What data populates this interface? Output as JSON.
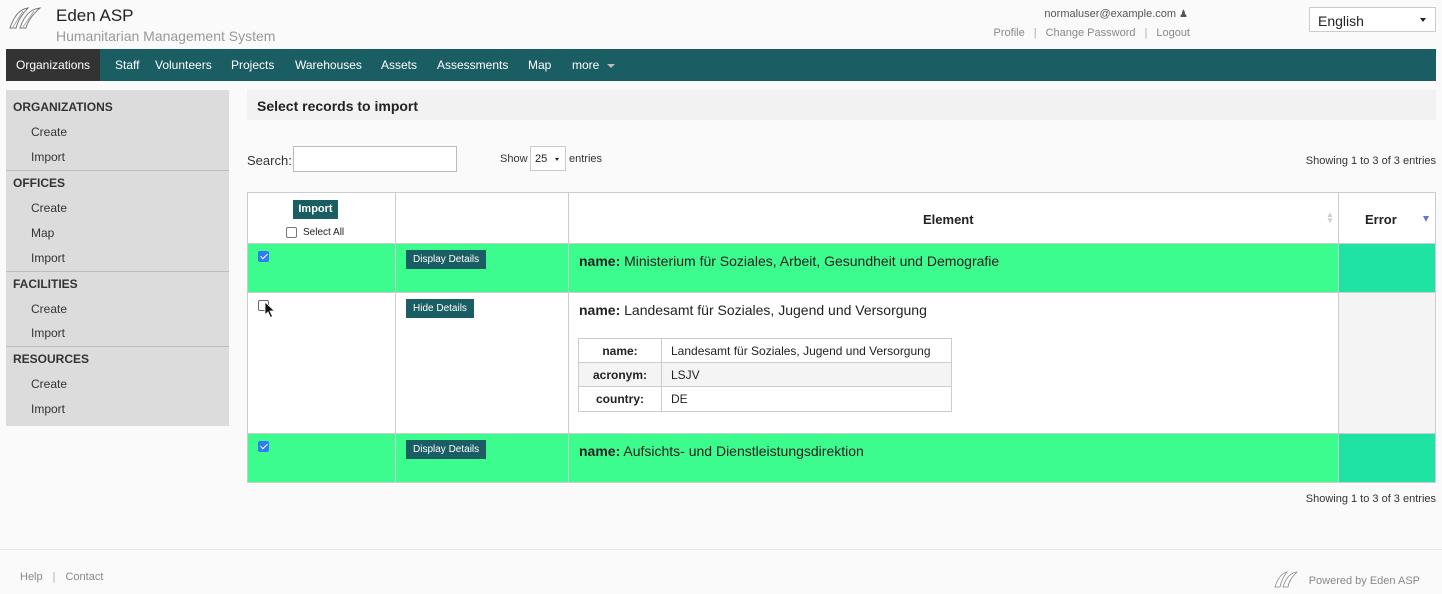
{
  "header": {
    "app_title": "Eden ASP",
    "app_subtitle": "Humanitarian Management System",
    "user_email": "normaluser@example.com",
    "links": {
      "profile": "Profile",
      "change_password": "Change Password",
      "logout": "Logout",
      "separator": "|"
    },
    "language": "English"
  },
  "nav": {
    "items": [
      "Organizations",
      "Staff",
      "Volunteers",
      "Projects",
      "Warehouses",
      "Assets",
      "Assessments",
      "Map",
      "more"
    ]
  },
  "sidebar": {
    "sections": [
      {
        "title": "ORGANIZATIONS",
        "items": [
          "Create",
          "Import"
        ]
      },
      {
        "title": "OFFICES",
        "items": [
          "Create",
          "Map",
          "Import"
        ]
      },
      {
        "title": "FACILITIES",
        "items": [
          "Create",
          "Import"
        ]
      },
      {
        "title": "RESOURCES",
        "items": [
          "Create",
          "Import"
        ]
      }
    ]
  },
  "main": {
    "title": "Select records to import",
    "search_label": "Search:",
    "search_value": "",
    "show_label": "Show",
    "page_size": "25",
    "entries_label": "entries",
    "showing_text": "Showing 1 to 3 of 3 entries"
  },
  "table": {
    "import_button": "Import",
    "select_all_label": "Select All",
    "col_element": "Element",
    "col_error": "Error",
    "name_key": "name:",
    "rows": [
      {
        "checked": true,
        "button": "Display Details",
        "name": "Ministerium für Soziales, Arbeit, Gesundheit und Demografie",
        "error": ""
      },
      {
        "checked": false,
        "button": "Hide Details",
        "name": "Landesamt für Soziales, Jugend und Versorgung",
        "error": "",
        "details": [
          {
            "key": "name:",
            "value": "Landesamt für Soziales, Jugend und Versorgung"
          },
          {
            "key": "acronym:",
            "value": "LSJV"
          },
          {
            "key": "country:",
            "value": "DE"
          }
        ]
      },
      {
        "checked": true,
        "button": "Display Details",
        "name": "Aufsichts- und Dienstleistungsdirektion",
        "error": ""
      }
    ]
  },
  "footer": {
    "help": "Help",
    "contact": "Contact",
    "separator": "|",
    "powered_by": "Powered by Eden ASP"
  },
  "colors": {
    "nav_bg": "#1a5e63",
    "row_selected": "#3dfc8e",
    "error_cell_selected": "#1ee3a3",
    "checkbox": "#2f7cf6"
  }
}
